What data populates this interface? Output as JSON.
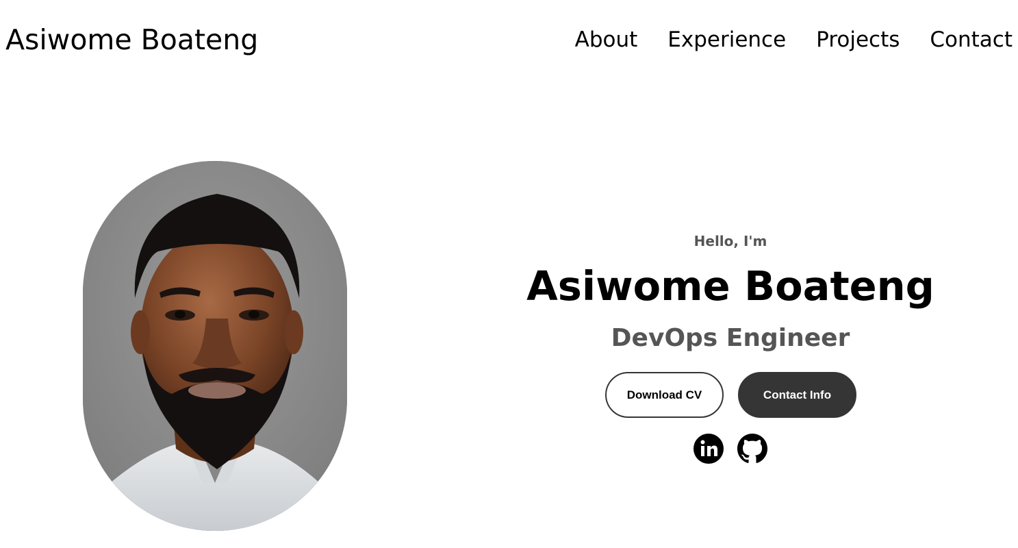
{
  "navbar": {
    "logo": "Asiwome Boateng",
    "links": [
      {
        "label": "About"
      },
      {
        "label": "Experience"
      },
      {
        "label": "Projects"
      },
      {
        "label": "Contact"
      }
    ]
  },
  "hero": {
    "greeting": "Hello, I'm",
    "name": "Asiwome Boateng",
    "role": "DevOps Engineer",
    "buttons": {
      "download_cv": "Download CV",
      "contact_info": "Contact Info"
    },
    "profile_image_alt": "Asiwome Boateng profile",
    "social": [
      {
        "icon": "linkedin-icon"
      },
      {
        "icon": "github-icon"
      }
    ]
  },
  "colors": {
    "text": "#000000",
    "muted": "#555555",
    "button_dark": "#353535",
    "background": "#ffffff"
  }
}
